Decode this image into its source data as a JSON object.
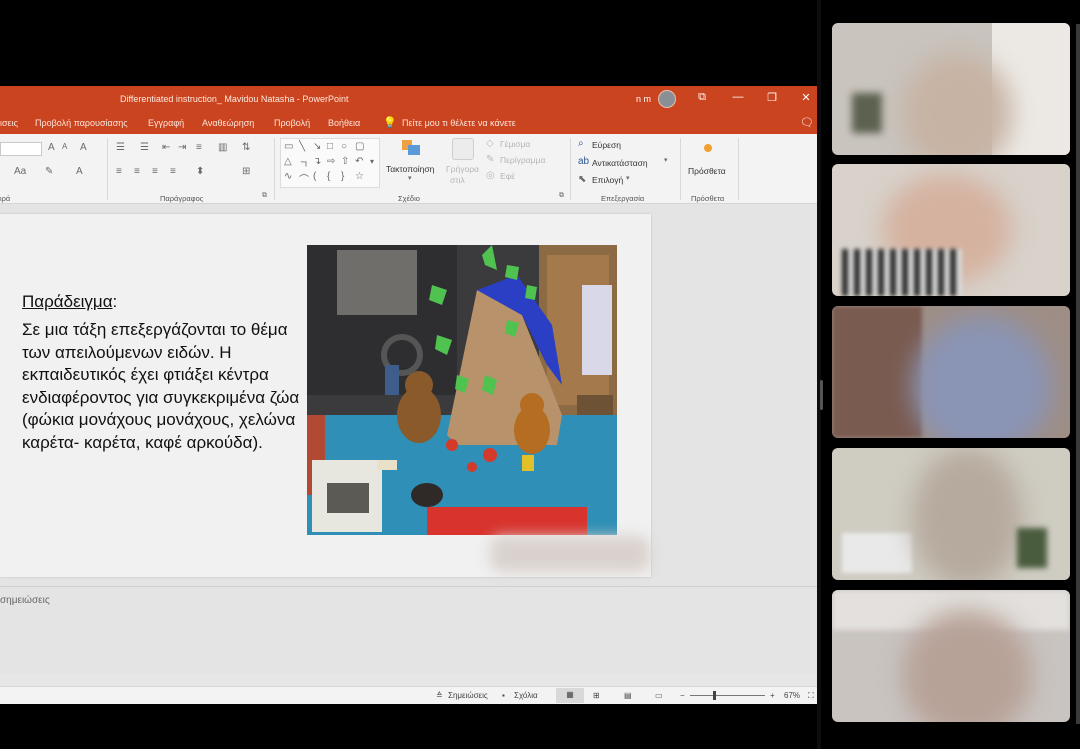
{
  "window": {
    "title": "Differentiated instruction_ Mavidou Natasha  -  PowerPoint",
    "user": "n m",
    "buttons": {
      "restore_ribbon": "⧉",
      "minimize": "—",
      "maximize": "❐",
      "close": "✕"
    }
  },
  "menu": {
    "tabs": [
      "ισεις",
      "Προβολή παρουσίασης",
      "Εγγραφή",
      "Αναθεώρηση",
      "Προβολή",
      "Βοήθεια"
    ],
    "tell_me": "Πείτε μου τι θέλετε να κάνετε"
  },
  "ribbon": {
    "groups": {
      "font_partial": "ιρά",
      "paragraph": "Παράγραφος",
      "drawing": "Σχέδιο",
      "editing": "Επεξεργασία",
      "addins": "Πρόσθετα"
    },
    "arrange": "Τακτοποίηση",
    "quick_styles": [
      "Γρήγορα",
      "στιλ"
    ],
    "shape_fill": "Γέμισμα",
    "shape_outline": "Περίγραμμα",
    "shape_effects": "Εφέ",
    "find": "Εύρεση",
    "replace": "Αντικατάσταση",
    "select": "Επιλογή",
    "addins_button": "Πρόσθετα"
  },
  "slide": {
    "heading": "Παράδειγμα",
    "heading_colon": ":",
    "body": "Σε μια τάξη επεξεργάζονται το θέμα των απειλούμενων ειδών. Η εκπαιδευτικός έχει φτιάξει κέντρα ενδιαφέροντος για συγκεκριμένα ζώα (φώκια μονάχους μονάχους, χελώνα καρέτα- καρέτα, καφέ αρκούδα)."
  },
  "notes": {
    "placeholder": "σημειώσεις"
  },
  "status": {
    "notes_label": "Σημειώσεις",
    "comments_label": "Σχόλια",
    "zoom": "67%",
    "zoom_minus": "−",
    "zoom_plus": "+"
  },
  "colors": {
    "accent": "#c9441f",
    "ribbon_bg": "#f3f3f3",
    "slide_bg": "#f1f1f1"
  },
  "participants": [
    {
      "name": "participant-1"
    },
    {
      "name": "participant-2"
    },
    {
      "name": "participant-3"
    },
    {
      "name": "participant-4"
    },
    {
      "name": "participant-5"
    }
  ]
}
